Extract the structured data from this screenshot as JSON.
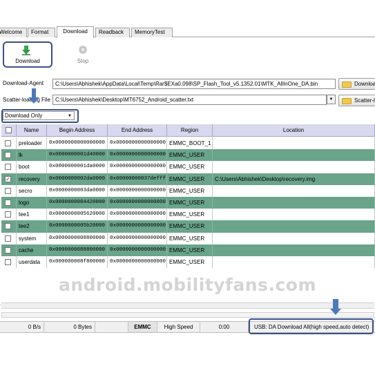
{
  "tabs": [
    {
      "label": "Welcome"
    },
    {
      "label": "Format"
    },
    {
      "label": "Download"
    },
    {
      "label": "Readback"
    },
    {
      "label": "MemoryTest"
    }
  ],
  "toolbar": {
    "download_label": "Download",
    "stop_label": "Stop",
    "download_icon": "download-arrow-icon",
    "stop_icon": "stop-icon"
  },
  "download_agent": {
    "label": "Download-Agent",
    "path": "C:\\Users\\Abhishek\\AppData\\Local\\Temp\\Rar$EXa0.098\\SP_Flash_Tool_v5.1352.01\\MTK_AllInOne_DA.bin",
    "button": "Download"
  },
  "scatter": {
    "label": "Scatter-loading File",
    "path": "C:\\Users\\Abhishek\\Desktop\\MT6752_Android_scatter.txt",
    "button": "Scatter-loading"
  },
  "mode": {
    "value": "Download Only"
  },
  "table": {
    "headers": [
      "Name",
      "Begin Address",
      "End Address",
      "Region",
      "Location"
    ],
    "rows": [
      {
        "checked": false,
        "name": "preloader",
        "begin": "0x0000000000000000",
        "end": "0x0000000000000000",
        "region": "EMMC_BOOT_1",
        "location": ""
      },
      {
        "checked": false,
        "name": "lk",
        "begin": "0x0000000001d40000",
        "end": "0x0000000000000000",
        "region": "EMMC_USER",
        "location": ""
      },
      {
        "checked": false,
        "name": "boot",
        "begin": "0x0000000001da0000",
        "end": "0x0000000000000000",
        "region": "EMMC_USER",
        "location": ""
      },
      {
        "checked": true,
        "name": "recovery",
        "begin": "0x0000000002da0000",
        "end": "0x00000000037defff",
        "region": "EMMC_USER",
        "location": "C:\\Users\\Abhishek\\Desktop\\recovery.img"
      },
      {
        "checked": false,
        "name": "secro",
        "begin": "0x0000000003da0000",
        "end": "0x0000000000000000",
        "region": "EMMC_USER",
        "location": ""
      },
      {
        "checked": false,
        "name": "logo",
        "begin": "0x0000000004420000",
        "end": "0x0000000000000000",
        "region": "EMMC_USER",
        "location": ""
      },
      {
        "checked": false,
        "name": "tee1",
        "begin": "0x0000000005620000",
        "end": "0x0000000000000000",
        "region": "EMMC_USER",
        "location": ""
      },
      {
        "checked": false,
        "name": "tee2",
        "begin": "0x0000000005b20000",
        "end": "0x0000000000000000",
        "region": "EMMC_USER",
        "location": ""
      },
      {
        "checked": false,
        "name": "system",
        "begin": "0x0000000008800000",
        "end": "0x0000000000000000",
        "region": "EMMC_USER",
        "location": ""
      },
      {
        "checked": false,
        "name": "cache",
        "begin": "0x0000000088800000",
        "end": "0x0000000000000000",
        "region": "EMMC_USER",
        "location": ""
      },
      {
        "checked": false,
        "name": "userdata",
        "begin": "0x000000008f800000",
        "end": "0x0000000000000000",
        "region": "EMMC_USER",
        "location": ""
      }
    ]
  },
  "watermark": "android.mobilityfans.com",
  "status_bar": {
    "speed": "0 B/s",
    "bytes": "0 Bytes",
    "storage": "EMMC",
    "speed_mode": "High Speed",
    "time": "0:00",
    "connection": "USB: DA Download All(high speed,auto detect)"
  },
  "colors": {
    "row_highlight": "#6aa48b",
    "header_bg": "#d8d8ee",
    "annotation_box": "#3a4f86",
    "annotation_arrow": "#4a7ab8"
  }
}
